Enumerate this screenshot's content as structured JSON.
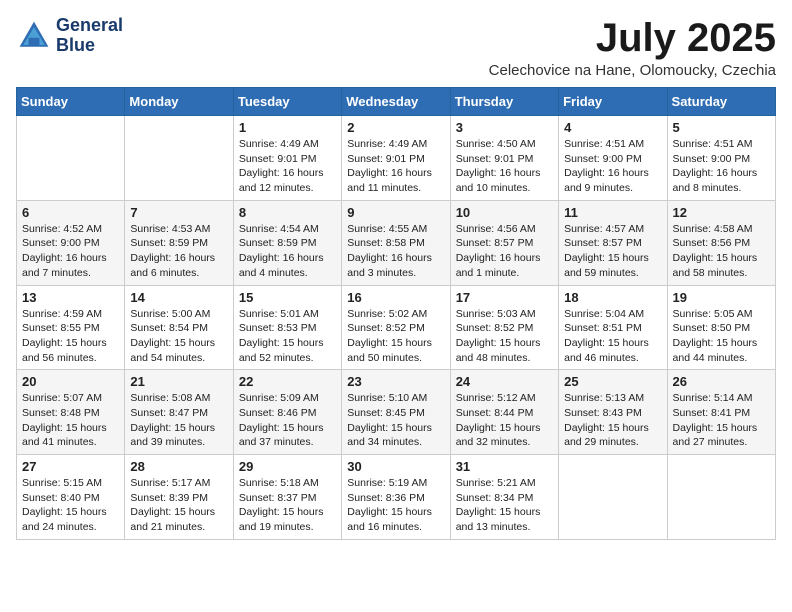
{
  "header": {
    "logo_line1": "General",
    "logo_line2": "Blue",
    "month": "July 2025",
    "location": "Celechovice na Hane, Olomoucky, Czechia"
  },
  "weekdays": [
    "Sunday",
    "Monday",
    "Tuesday",
    "Wednesday",
    "Thursday",
    "Friday",
    "Saturday"
  ],
  "weeks": [
    [
      {
        "day": "",
        "info": ""
      },
      {
        "day": "",
        "info": ""
      },
      {
        "day": "1",
        "info": "Sunrise: 4:49 AM\nSunset: 9:01 PM\nDaylight: 16 hours and 12 minutes."
      },
      {
        "day": "2",
        "info": "Sunrise: 4:49 AM\nSunset: 9:01 PM\nDaylight: 16 hours and 11 minutes."
      },
      {
        "day": "3",
        "info": "Sunrise: 4:50 AM\nSunset: 9:01 PM\nDaylight: 16 hours and 10 minutes."
      },
      {
        "day": "4",
        "info": "Sunrise: 4:51 AM\nSunset: 9:00 PM\nDaylight: 16 hours and 9 minutes."
      },
      {
        "day": "5",
        "info": "Sunrise: 4:51 AM\nSunset: 9:00 PM\nDaylight: 16 hours and 8 minutes."
      }
    ],
    [
      {
        "day": "6",
        "info": "Sunrise: 4:52 AM\nSunset: 9:00 PM\nDaylight: 16 hours and 7 minutes."
      },
      {
        "day": "7",
        "info": "Sunrise: 4:53 AM\nSunset: 8:59 PM\nDaylight: 16 hours and 6 minutes."
      },
      {
        "day": "8",
        "info": "Sunrise: 4:54 AM\nSunset: 8:59 PM\nDaylight: 16 hours and 4 minutes."
      },
      {
        "day": "9",
        "info": "Sunrise: 4:55 AM\nSunset: 8:58 PM\nDaylight: 16 hours and 3 minutes."
      },
      {
        "day": "10",
        "info": "Sunrise: 4:56 AM\nSunset: 8:57 PM\nDaylight: 16 hours and 1 minute."
      },
      {
        "day": "11",
        "info": "Sunrise: 4:57 AM\nSunset: 8:57 PM\nDaylight: 15 hours and 59 minutes."
      },
      {
        "day": "12",
        "info": "Sunrise: 4:58 AM\nSunset: 8:56 PM\nDaylight: 15 hours and 58 minutes."
      }
    ],
    [
      {
        "day": "13",
        "info": "Sunrise: 4:59 AM\nSunset: 8:55 PM\nDaylight: 15 hours and 56 minutes."
      },
      {
        "day": "14",
        "info": "Sunrise: 5:00 AM\nSunset: 8:54 PM\nDaylight: 15 hours and 54 minutes."
      },
      {
        "day": "15",
        "info": "Sunrise: 5:01 AM\nSunset: 8:53 PM\nDaylight: 15 hours and 52 minutes."
      },
      {
        "day": "16",
        "info": "Sunrise: 5:02 AM\nSunset: 8:52 PM\nDaylight: 15 hours and 50 minutes."
      },
      {
        "day": "17",
        "info": "Sunrise: 5:03 AM\nSunset: 8:52 PM\nDaylight: 15 hours and 48 minutes."
      },
      {
        "day": "18",
        "info": "Sunrise: 5:04 AM\nSunset: 8:51 PM\nDaylight: 15 hours and 46 minutes."
      },
      {
        "day": "19",
        "info": "Sunrise: 5:05 AM\nSunset: 8:50 PM\nDaylight: 15 hours and 44 minutes."
      }
    ],
    [
      {
        "day": "20",
        "info": "Sunrise: 5:07 AM\nSunset: 8:48 PM\nDaylight: 15 hours and 41 minutes."
      },
      {
        "day": "21",
        "info": "Sunrise: 5:08 AM\nSunset: 8:47 PM\nDaylight: 15 hours and 39 minutes."
      },
      {
        "day": "22",
        "info": "Sunrise: 5:09 AM\nSunset: 8:46 PM\nDaylight: 15 hours and 37 minutes."
      },
      {
        "day": "23",
        "info": "Sunrise: 5:10 AM\nSunset: 8:45 PM\nDaylight: 15 hours and 34 minutes."
      },
      {
        "day": "24",
        "info": "Sunrise: 5:12 AM\nSunset: 8:44 PM\nDaylight: 15 hours and 32 minutes."
      },
      {
        "day": "25",
        "info": "Sunrise: 5:13 AM\nSunset: 8:43 PM\nDaylight: 15 hours and 29 minutes."
      },
      {
        "day": "26",
        "info": "Sunrise: 5:14 AM\nSunset: 8:41 PM\nDaylight: 15 hours and 27 minutes."
      }
    ],
    [
      {
        "day": "27",
        "info": "Sunrise: 5:15 AM\nSunset: 8:40 PM\nDaylight: 15 hours and 24 minutes."
      },
      {
        "day": "28",
        "info": "Sunrise: 5:17 AM\nSunset: 8:39 PM\nDaylight: 15 hours and 21 minutes."
      },
      {
        "day": "29",
        "info": "Sunrise: 5:18 AM\nSunset: 8:37 PM\nDaylight: 15 hours and 19 minutes."
      },
      {
        "day": "30",
        "info": "Sunrise: 5:19 AM\nSunset: 8:36 PM\nDaylight: 15 hours and 16 minutes."
      },
      {
        "day": "31",
        "info": "Sunrise: 5:21 AM\nSunset: 8:34 PM\nDaylight: 15 hours and 13 minutes."
      },
      {
        "day": "",
        "info": ""
      },
      {
        "day": "",
        "info": ""
      }
    ]
  ]
}
